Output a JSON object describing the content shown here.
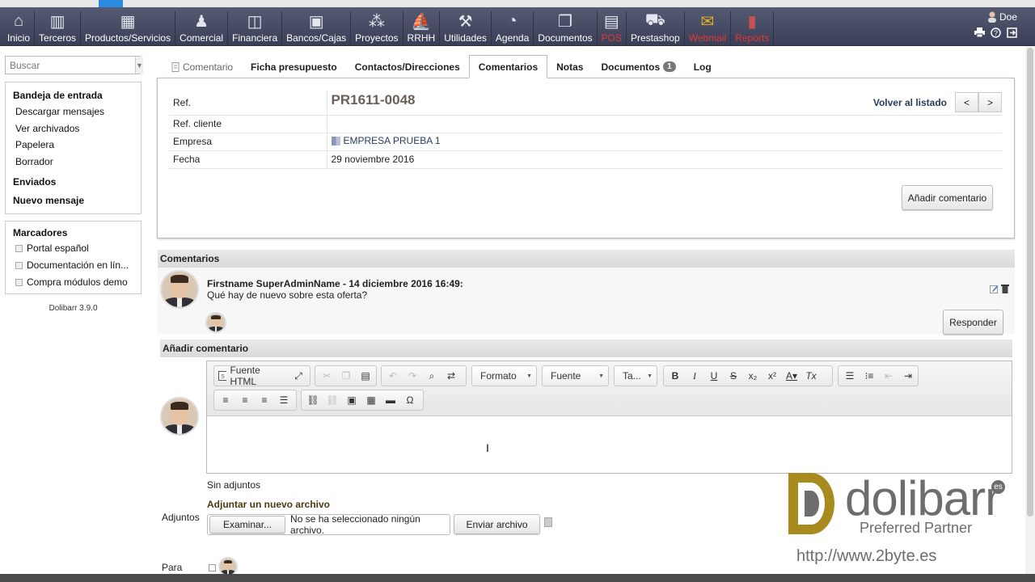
{
  "menu": [
    {
      "label": "Inicio",
      "icon": "home-icon",
      "red": false
    },
    {
      "label": "Terceros",
      "icon": "buildings-icon",
      "red": false
    },
    {
      "label": "Productos/Servicios",
      "icon": "boxes-icon",
      "red": false
    },
    {
      "label": "Comercial",
      "icon": "commercial-icon",
      "red": false
    },
    {
      "label": "Financiera",
      "icon": "finance-icon",
      "red": false
    },
    {
      "label": "Bancos/Cajas",
      "icon": "bank-icon",
      "red": false
    },
    {
      "label": "Proyectos",
      "icon": "project-icon",
      "red": false
    },
    {
      "label": "RRHH",
      "icon": "hr-icon",
      "red": false
    },
    {
      "label": "Utilidades",
      "icon": "tools-icon",
      "red": false
    },
    {
      "label": "Agenda",
      "icon": "agenda-icon",
      "red": false
    },
    {
      "label": "Documentos",
      "icon": "documents-icon",
      "red": false
    },
    {
      "label": "POS",
      "icon": "cash-register-icon",
      "red": true
    },
    {
      "label": "Prestashop",
      "icon": "cart-icon",
      "red": false
    },
    {
      "label": "Webmail",
      "icon": "mail-icon",
      "red": true
    },
    {
      "label": "Reports",
      "icon": "reports-icon",
      "red": true
    }
  ],
  "user": {
    "name": "Doe"
  },
  "search": {
    "placeholder": "Buscar"
  },
  "sidebar": {
    "inbox_title": "Bandeja de entrada",
    "inbox_items": [
      "Descargar mensajes",
      "Ver archivados",
      "Papelera",
      "Borrador"
    ],
    "sent": "Enviados",
    "new_message": "Nuevo mensaje",
    "bookmarks_title": "Marcadores",
    "bookmarks": [
      "Portal español",
      "Documentación en lín...",
      "Compra módulos demo"
    ],
    "version": "Dolibarr 3.9.0"
  },
  "tabs": {
    "t0": "Comentario",
    "t1": "Ficha presupuesto",
    "t2": "Contactos/Direcciones",
    "t3": "Comentarios",
    "t4": "Notas",
    "t5": "Documentos",
    "t5_badge": "1",
    "t6": "Log"
  },
  "record": {
    "ref_label": "Ref.",
    "ref_value": "PR1611-0048",
    "back_label": "Volver al listado",
    "prev": "<",
    "next": ">",
    "refclient_label": "Ref. cliente",
    "refclient_value": "",
    "company_label": "Empresa",
    "company_value": "EMPRESA PRUEBA 1",
    "date_label": "Fecha",
    "date_value": "29 noviembre 2016",
    "add_comment_btn": "Añadir comentario"
  },
  "comments": {
    "title": "Comentarios",
    "author_line": "Firstname SuperAdminName - 14 diciembre 2016 16:49:",
    "text": "Qué hay de nuevo sobre esta oferta?",
    "reply_btn": "Responder"
  },
  "add_comment": {
    "title": "Añadir comentario",
    "toolbar": {
      "source": "Fuente HTML",
      "format": "Formato",
      "font": "Fuente",
      "size": "Ta..."
    },
    "no_attachments": "Sin adjuntos",
    "attach_new": "Adjuntar un nuevo archivo",
    "attach_label": "Adjuntos",
    "browse": "Examinar...",
    "no_file": "No se ha seleccionado ningún archivo.",
    "send_file": "Enviar archivo",
    "to_label": "Para"
  },
  "watermark": {
    "brand": "dolibarr",
    "es": "es",
    "partner": "Preferred Partner",
    "url": "http://www.2byte.es"
  }
}
